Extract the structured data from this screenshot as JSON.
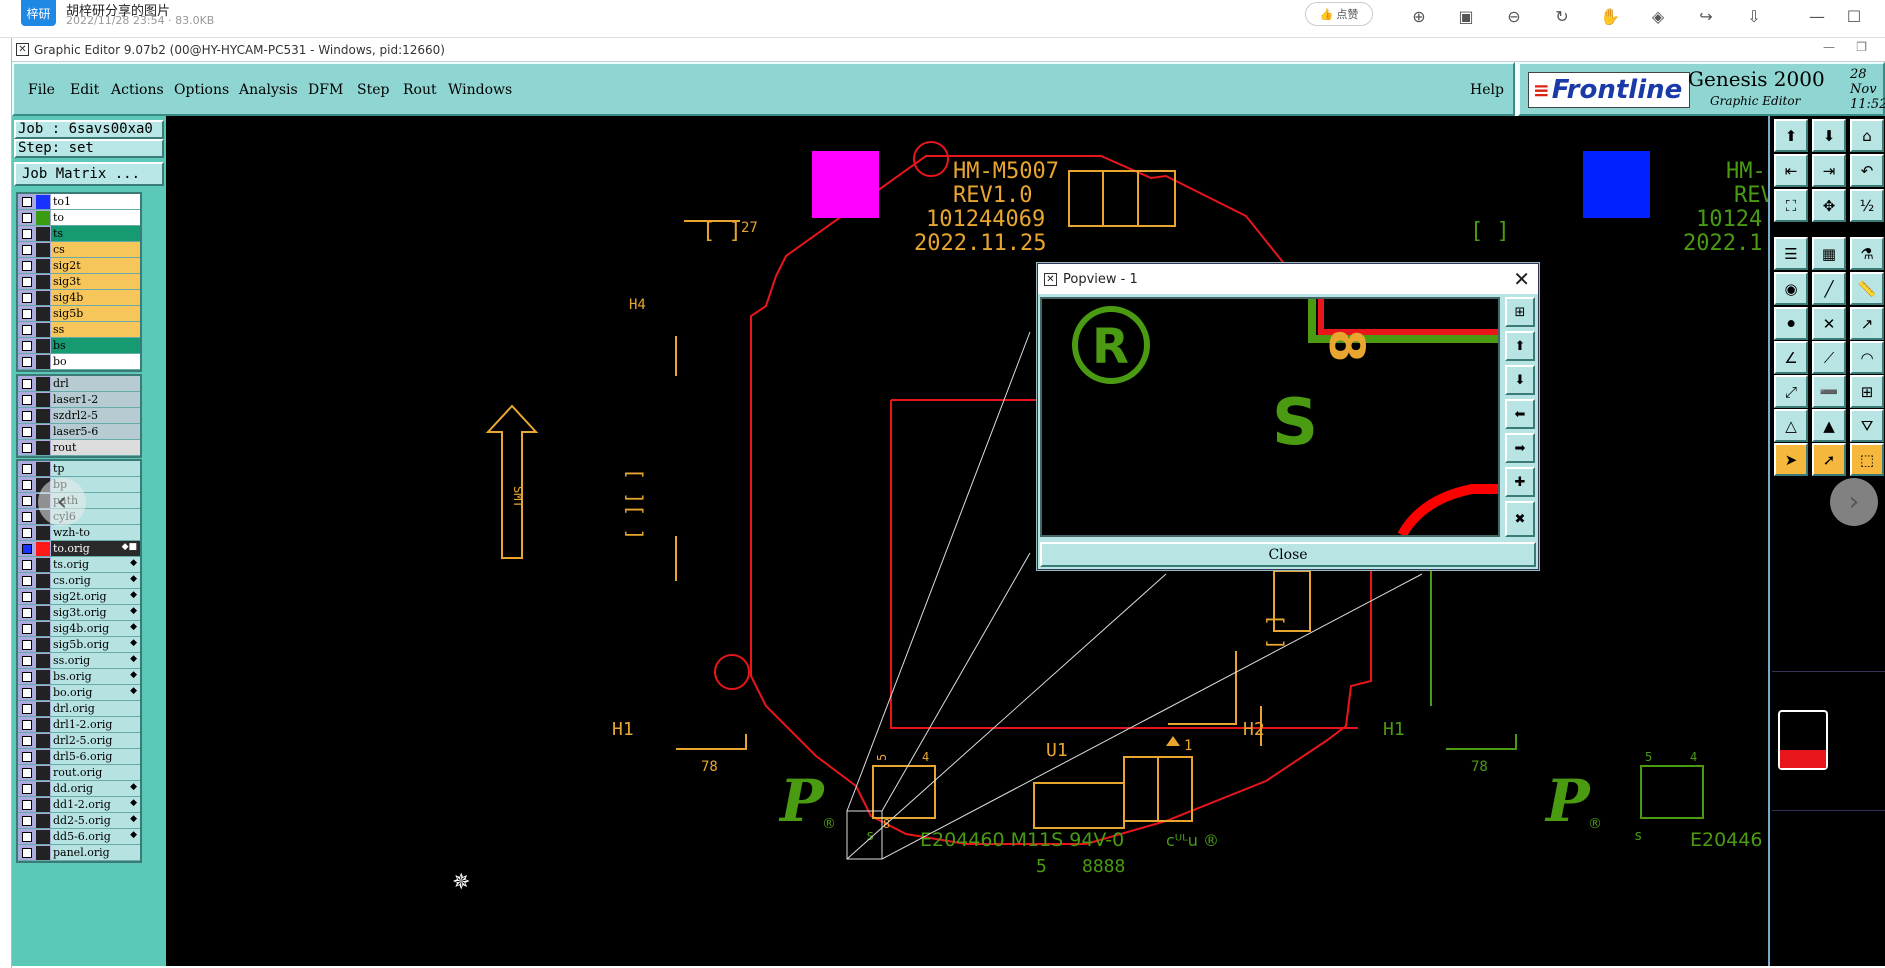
{
  "viewer": {
    "app_badge": "梓研",
    "file_name": "胡梓研分享的图片",
    "file_meta": "2022/11/28 23:54 · 83.0KB",
    "like_label": "点赞"
  },
  "window": {
    "title": "Graphic Editor 9.07b2 (00@HY-HYCAM-PC531 - Windows, pid:12660)"
  },
  "menu": {
    "items": [
      "File",
      "Edit",
      "Actions",
      "Options",
      "Analysis",
      "DFM",
      "Step",
      "Rout",
      "Windows"
    ],
    "help": "Help"
  },
  "brand": {
    "logo_text": "Frontline",
    "product": "Genesis 2000",
    "subtitle": "Graphic Editor",
    "date_line1": "28 Nov",
    "date_line2": "11:52"
  },
  "job": {
    "job_label": "Job : 6savs00xa0",
    "step_label": "Step: set",
    "matrix_button": "Job Matrix ..."
  },
  "colors": {
    "board_red": "#e8161b",
    "silk_orange": "#e8a630",
    "green_mark": "#4a9a12",
    "magenta": "#ff00ff",
    "blue": "#0022ff",
    "panel_teal": "#8fd6d3"
  },
  "layers_group1": [
    {
      "name": "to1",
      "color": "#1832ff",
      "bg": "#ffffff"
    },
    {
      "name": "to",
      "color": "#3b9c12",
      "bg": "#ffffff"
    },
    {
      "name": "ts",
      "color": "",
      "bg": "#169a72"
    },
    {
      "name": "cs",
      "color": "",
      "bg": "#f6c65a"
    },
    {
      "name": "sig2t",
      "color": "",
      "bg": "#f6c65a"
    },
    {
      "name": "sig3t",
      "color": "",
      "bg": "#f6c65a"
    },
    {
      "name": "sig4b",
      "color": "",
      "bg": "#f6c65a"
    },
    {
      "name": "sig5b",
      "color": "",
      "bg": "#f6c65a"
    },
    {
      "name": "ss",
      "color": "",
      "bg": "#f6c65a"
    },
    {
      "name": "bs",
      "color": "",
      "bg": "#169a72"
    },
    {
      "name": "bo",
      "color": "",
      "bg": "#ffffff"
    }
  ],
  "layers_group2": [
    {
      "name": "drl",
      "bg": "#b7cbd3"
    },
    {
      "name": "laser1-2",
      "bg": "#b7cbd3"
    },
    {
      "name": "szdrl2-5",
      "bg": "#b7cbd3"
    },
    {
      "name": "laser5-6",
      "bg": "#b7cbd3"
    },
    {
      "name": "rout",
      "bg": "#dddddd"
    }
  ],
  "layers_group3": [
    {
      "name": "tp",
      "icon": ""
    },
    {
      "name": "bp",
      "icon": ""
    },
    {
      "name": "path",
      "icon": ""
    },
    {
      "name": "cyl6",
      "icon": ""
    },
    {
      "name": "wzh-to",
      "icon": ""
    },
    {
      "name": "to.orig",
      "icon": "◆■"
    },
    {
      "name": "ts.orig",
      "icon": "◆"
    },
    {
      "name": "cs.orig",
      "icon": "◆"
    },
    {
      "name": "sig2t.orig",
      "icon": "◆"
    },
    {
      "name": "sig3t.orig",
      "icon": "◆"
    },
    {
      "name": "sig4b.orig",
      "icon": "◆"
    },
    {
      "name": "sig5b.orig",
      "icon": "◆"
    },
    {
      "name": "ss.orig",
      "icon": "◆"
    },
    {
      "name": "bs.orig",
      "icon": "◆"
    },
    {
      "name": "bo.orig",
      "icon": "◆"
    },
    {
      "name": "drl.orig",
      "icon": ""
    },
    {
      "name": "drl1-2.orig",
      "icon": ""
    },
    {
      "name": "drl2-5.orig",
      "icon": ""
    },
    {
      "name": "drl5-6.orig",
      "icon": ""
    },
    {
      "name": "rout.orig",
      "icon": ""
    },
    {
      "name": "dd.orig",
      "icon": "◆"
    },
    {
      "name": "dd1-2.orig",
      "icon": "◆"
    },
    {
      "name": "dd2-5.orig",
      "icon": "◆"
    },
    {
      "name": "dd5-6.orig",
      "icon": "◆"
    },
    {
      "name": "panel.orig",
      "icon": ""
    }
  ],
  "board": {
    "model": "HM-M5007",
    "rev": "REV1.0",
    "part": "101244069",
    "date": "2022.11.25",
    "model_right": "HM-",
    "rev_right": "REV",
    "part_right": "10124",
    "date_right": "2022.1",
    "smt": "SMT",
    "label_h1": "H1",
    "label_h2": "H2",
    "label_h1_right": "H1",
    "label_h4": "H4",
    "label_27": "27",
    "label_78": "78",
    "label_78_right": "78",
    "label_u1": "U1",
    "label_1": "1",
    "label_5": "5",
    "label_4": "4",
    "label_s": "s",
    "label_8": "8",
    "label_5b": "5",
    "label_4b": "4",
    "label_sb": "s",
    "ul_text": "E204460 M11S 94V-0",
    "ul_text_right": "E20446",
    "code_5": "5",
    "code_8888": "8888",
    "p_mark": "P",
    "reg": "®"
  },
  "popview": {
    "title": "Popview - 1",
    "close_label": "Close",
    "s_char": "S",
    "eight": "8",
    "reg": "®"
  }
}
